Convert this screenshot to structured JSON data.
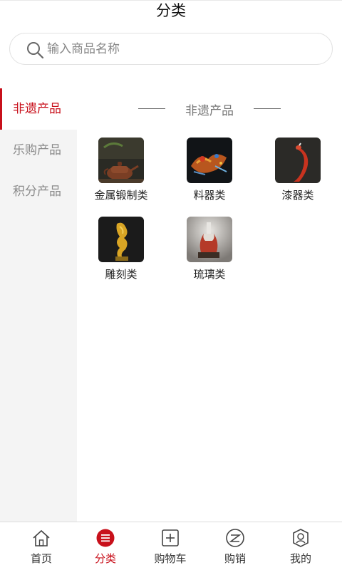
{
  "header": {
    "title": "分类"
  },
  "search": {
    "placeholder": "输入商品名称"
  },
  "sidebar": {
    "items": [
      {
        "label": "非遗产品",
        "active": true
      },
      {
        "label": "乐购产品",
        "active": false
      },
      {
        "label": "积分产品",
        "active": false
      }
    ]
  },
  "section": {
    "title": "非遗产品"
  },
  "categories": [
    {
      "label": "金属锻制类",
      "icon": "teapot-image"
    },
    {
      "label": "料器类",
      "icon": "glass-figure-image"
    },
    {
      "label": "漆器类",
      "icon": "red-lacquer-image"
    },
    {
      "label": "雕刻类",
      "icon": "gold-carving-image"
    },
    {
      "label": "琉璃类",
      "icon": "glaze-vase-image"
    }
  ],
  "tabbar": {
    "items": [
      {
        "label": "首页",
        "icon": "home-icon",
        "active": false
      },
      {
        "label": "分类",
        "icon": "category-icon",
        "active": true
      },
      {
        "label": "购物车",
        "icon": "cart-icon",
        "active": false
      },
      {
        "label": "购销",
        "icon": "trade-icon",
        "active": false
      },
      {
        "label": "我的",
        "icon": "profile-icon",
        "active": false
      }
    ]
  },
  "colors": {
    "accent": "#c8101b",
    "sidebar_bg": "#f4f4f4"
  }
}
